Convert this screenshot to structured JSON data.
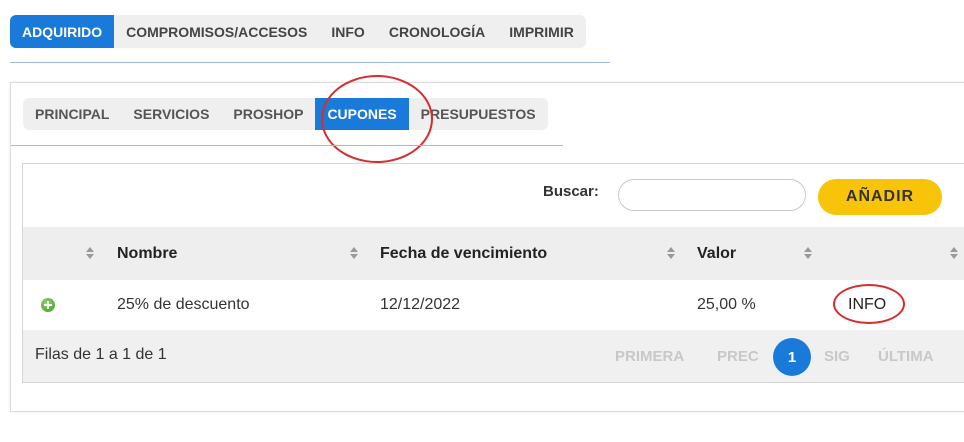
{
  "top_tabs": [
    "ADQUIRIDO",
    "COMPROMISOS/ACCESOS",
    "INFO",
    "CRONOLOGÍA",
    "IMPRIMIR"
  ],
  "sub_tabs": [
    "PRINCIPAL",
    "SERVICIOS",
    "PROSHOP",
    "CUPONES",
    "PRESUPUESTOS"
  ],
  "search": {
    "label": "Buscar:",
    "value": ""
  },
  "add_button": "AÑADIR",
  "table": {
    "headers": [
      "Nombre",
      "Fecha de vencimiento",
      "Valor"
    ],
    "rows": [
      {
        "nombre": "25% de descuento",
        "fecha": "12/12/2022",
        "valor": "25,00 %",
        "action": "INFO"
      }
    ]
  },
  "footer": {
    "rows_info": "Filas de 1 a 1 de 1",
    "first": "PRIMERA",
    "prev": "PREC",
    "page": "1",
    "next": "SIG",
    "last": "ÚLTIMA"
  },
  "colors": {
    "accent": "#1a7ad9",
    "add_button": "#f8c40a",
    "highlight": "#d62d2d"
  }
}
